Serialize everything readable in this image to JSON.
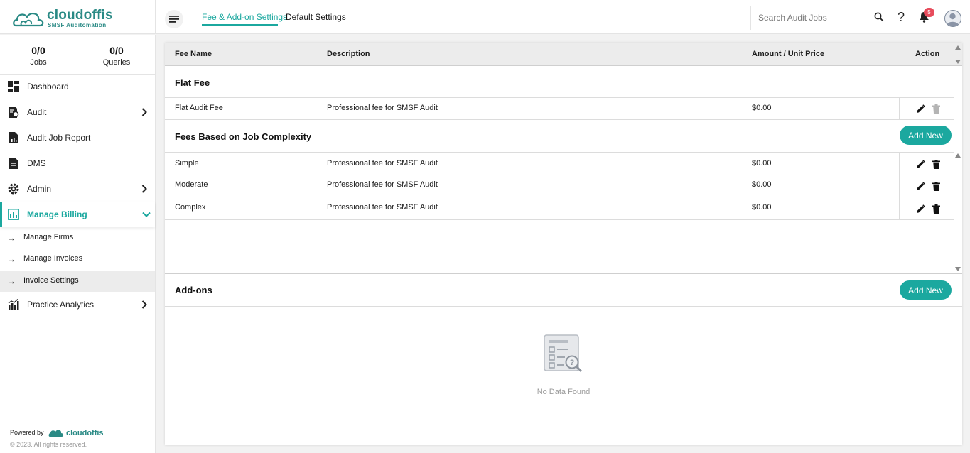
{
  "brand": {
    "name": "cloudoffis",
    "tagline": "SMSF Auditomation",
    "color": "#2a8a85"
  },
  "tabs": [
    {
      "label": "Fee & Add-on Settings",
      "active": true
    },
    {
      "label": "Default Settings",
      "active": false
    }
  ],
  "search": {
    "placeholder": "Search Audit Jobs",
    "value": ""
  },
  "header_icons": {
    "help": "?",
    "notification_count": "5"
  },
  "stats": [
    {
      "value": "0/0",
      "label": "Jobs"
    },
    {
      "value": "0/0",
      "label": "Queries"
    }
  ],
  "sidebar": {
    "items": [
      {
        "label": "Dashboard",
        "icon": "dashboard-icon"
      },
      {
        "label": "Audit",
        "icon": "audit-icon",
        "has_chevron": true
      },
      {
        "label": "Audit Job Report",
        "icon": "report-icon"
      },
      {
        "label": "DMS",
        "icon": "document-icon"
      },
      {
        "label": "Admin",
        "icon": "gear-icon",
        "has_chevron": true
      },
      {
        "label": "Manage Billing",
        "icon": "billing-icon",
        "expanded": true
      }
    ],
    "sub_items": [
      {
        "label": "Manage Firms"
      },
      {
        "label": "Manage Invoices"
      },
      {
        "label": "Invoice Settings",
        "active": true
      }
    ],
    "after": {
      "label": "Practice Analytics",
      "icon": "analytics-icon"
    },
    "powered_by": "Powered by",
    "powered_name": "cloudoffis",
    "copyright": "© 2023. All rights reserved."
  },
  "table": {
    "headers": {
      "fee_name": "Fee Name",
      "description": "Description",
      "amount": "Amount / Unit Price",
      "action": "Action"
    },
    "flat_fee": {
      "title": "Flat Fee",
      "rows": [
        {
          "name": "Flat Audit Fee",
          "description": "Professional fee for SMSF Audit",
          "amount": "$0.00"
        }
      ]
    },
    "complexity": {
      "title": "Fees Based on Job Complexity",
      "add_label": "Add New",
      "rows": [
        {
          "name": "Simple",
          "description": "Professional fee for SMSF Audit",
          "amount": "$0.00"
        },
        {
          "name": "Moderate",
          "description": "Professional fee for SMSF Audit",
          "amount": "$0.00"
        },
        {
          "name": "Complex",
          "description": "Professional fee for SMSF Audit",
          "amount": "$0.00"
        }
      ]
    },
    "addons": {
      "title": "Add-ons",
      "add_label": "Add New",
      "empty_text": "No Data Found"
    }
  },
  "colors": {
    "accent": "#1ba89f",
    "badge": "#e74c5c"
  }
}
